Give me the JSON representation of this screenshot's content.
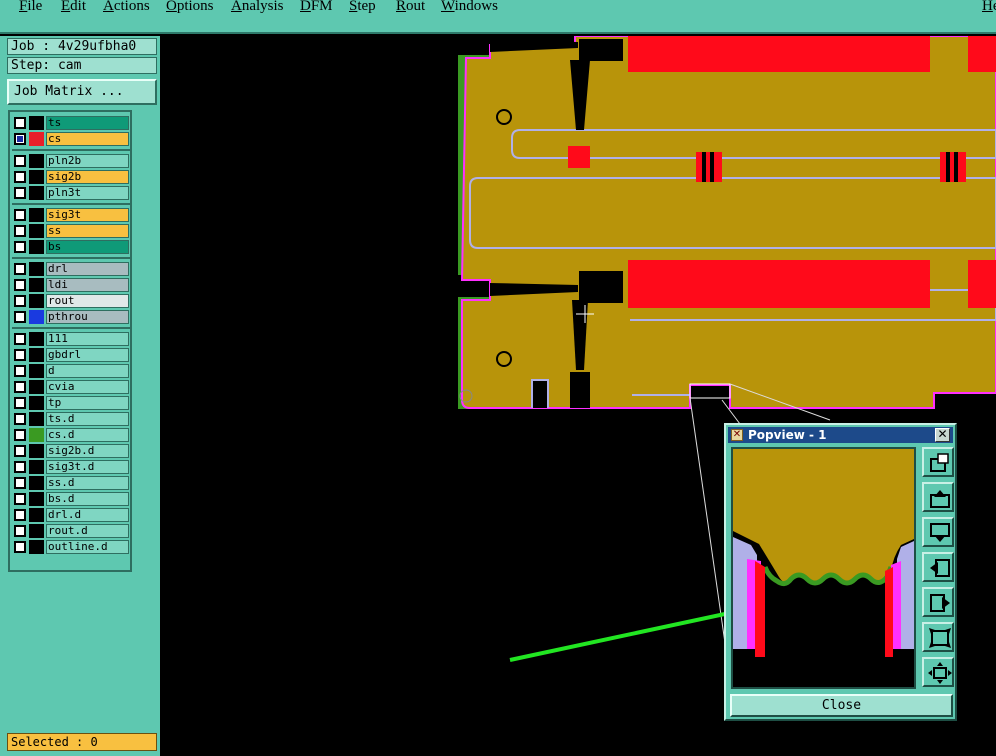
{
  "menu": {
    "items": [
      "File",
      "Edit",
      "Actions",
      "Options",
      "Analysis",
      "DFM",
      "Step",
      "Rout",
      "Windows"
    ],
    "right_label": "He"
  },
  "left_panel": {
    "job_label": "Job : 4v29ufbha0",
    "step_label": "Step: cam",
    "job_matrix_label": "Job Matrix ...",
    "selected_label": "Selected : 0"
  },
  "layers": [
    {
      "name": "ts",
      "color": "#0f9a78",
      "swatch": "#000000",
      "selected": false
    },
    {
      "name": "cs",
      "color": "#f8c040",
      "swatch": "#e8202a",
      "selected": true
    },
    {
      "name": "pln2b",
      "color": "#7fd6c2",
      "swatch": "#000000",
      "selected": false
    },
    {
      "name": "sig2b",
      "color": "#f8c040",
      "swatch": "#000000",
      "selected": false
    },
    {
      "name": "pln3t",
      "color": "#7fd6c2",
      "swatch": "#000000",
      "selected": false
    },
    {
      "name": "sig3t",
      "color": "#f8c040",
      "swatch": "#000000",
      "selected": false
    },
    {
      "name": "ss",
      "color": "#f8c040",
      "swatch": "#000000",
      "selected": false
    },
    {
      "name": "bs",
      "color": "#0f9a78",
      "swatch": "#000000",
      "selected": false
    },
    {
      "name": "drl",
      "color": "#a8bcc0",
      "swatch": "#000000",
      "selected": false
    },
    {
      "name": "ldi",
      "color": "#a8bcc0",
      "swatch": "#000000",
      "selected": false
    },
    {
      "name": "rout",
      "color": "#e0e8e8",
      "swatch": "#000000",
      "selected": false
    },
    {
      "name": "pthrou",
      "color": "#a8bcc0",
      "swatch": "#1a3ae0",
      "selected": false
    },
    {
      "name": "111",
      "color": "#7fd6c2",
      "swatch": "#000000",
      "selected": false
    },
    {
      "name": "gbdrl",
      "color": "#7fd6c2",
      "swatch": "#000000",
      "selected": false
    },
    {
      "name": "d",
      "color": "#7fd6c2",
      "swatch": "#000000",
      "selected": false
    },
    {
      "name": "cvia",
      "color": "#7fd6c2",
      "swatch": "#000000",
      "selected": false
    },
    {
      "name": "tp",
      "color": "#7fd6c2",
      "swatch": "#000000",
      "selected": false
    },
    {
      "name": "ts.d",
      "color": "#7fd6c2",
      "swatch": "#000000",
      "selected": false
    },
    {
      "name": "cs.d",
      "color": "#7fd6c2",
      "swatch": "#3a9a22",
      "selected": false
    },
    {
      "name": "sig2b.d",
      "color": "#7fd6c2",
      "swatch": "#000000",
      "selected": false
    },
    {
      "name": "sig3t.d",
      "color": "#7fd6c2",
      "swatch": "#000000",
      "selected": false
    },
    {
      "name": "ss.d",
      "color": "#7fd6c2",
      "swatch": "#000000",
      "selected": false
    },
    {
      "name": "bs.d",
      "color": "#7fd6c2",
      "swatch": "#000000",
      "selected": false
    },
    {
      "name": "drl.d",
      "color": "#7fd6c2",
      "swatch": "#000000",
      "selected": false
    },
    {
      "name": "rout.d",
      "color": "#7fd6c2",
      "swatch": "#000000",
      "selected": false
    },
    {
      "name": "outline.d",
      "color": "#7fd6c2",
      "swatch": "#000000",
      "selected": false
    }
  ],
  "popview": {
    "title": "Popview - 1",
    "close_x": "✕",
    "close_label": "Close",
    "tools": [
      "zoom-window-icon",
      "pan-up-icon",
      "pan-down-icon",
      "pan-left-icon",
      "pan-right-icon",
      "zoom-fit-icon",
      "zoom-home-icon"
    ]
  },
  "colors": {
    "copper": "#b8940a",
    "pad_red": "#ff0a1a",
    "mask_green": "#3a9a22",
    "outline_lavender": "#b0b0e8",
    "outline_magenta": "#ff30ff",
    "annotation_arrow": "#22e622",
    "ui_teal": "#5ec8b0"
  }
}
